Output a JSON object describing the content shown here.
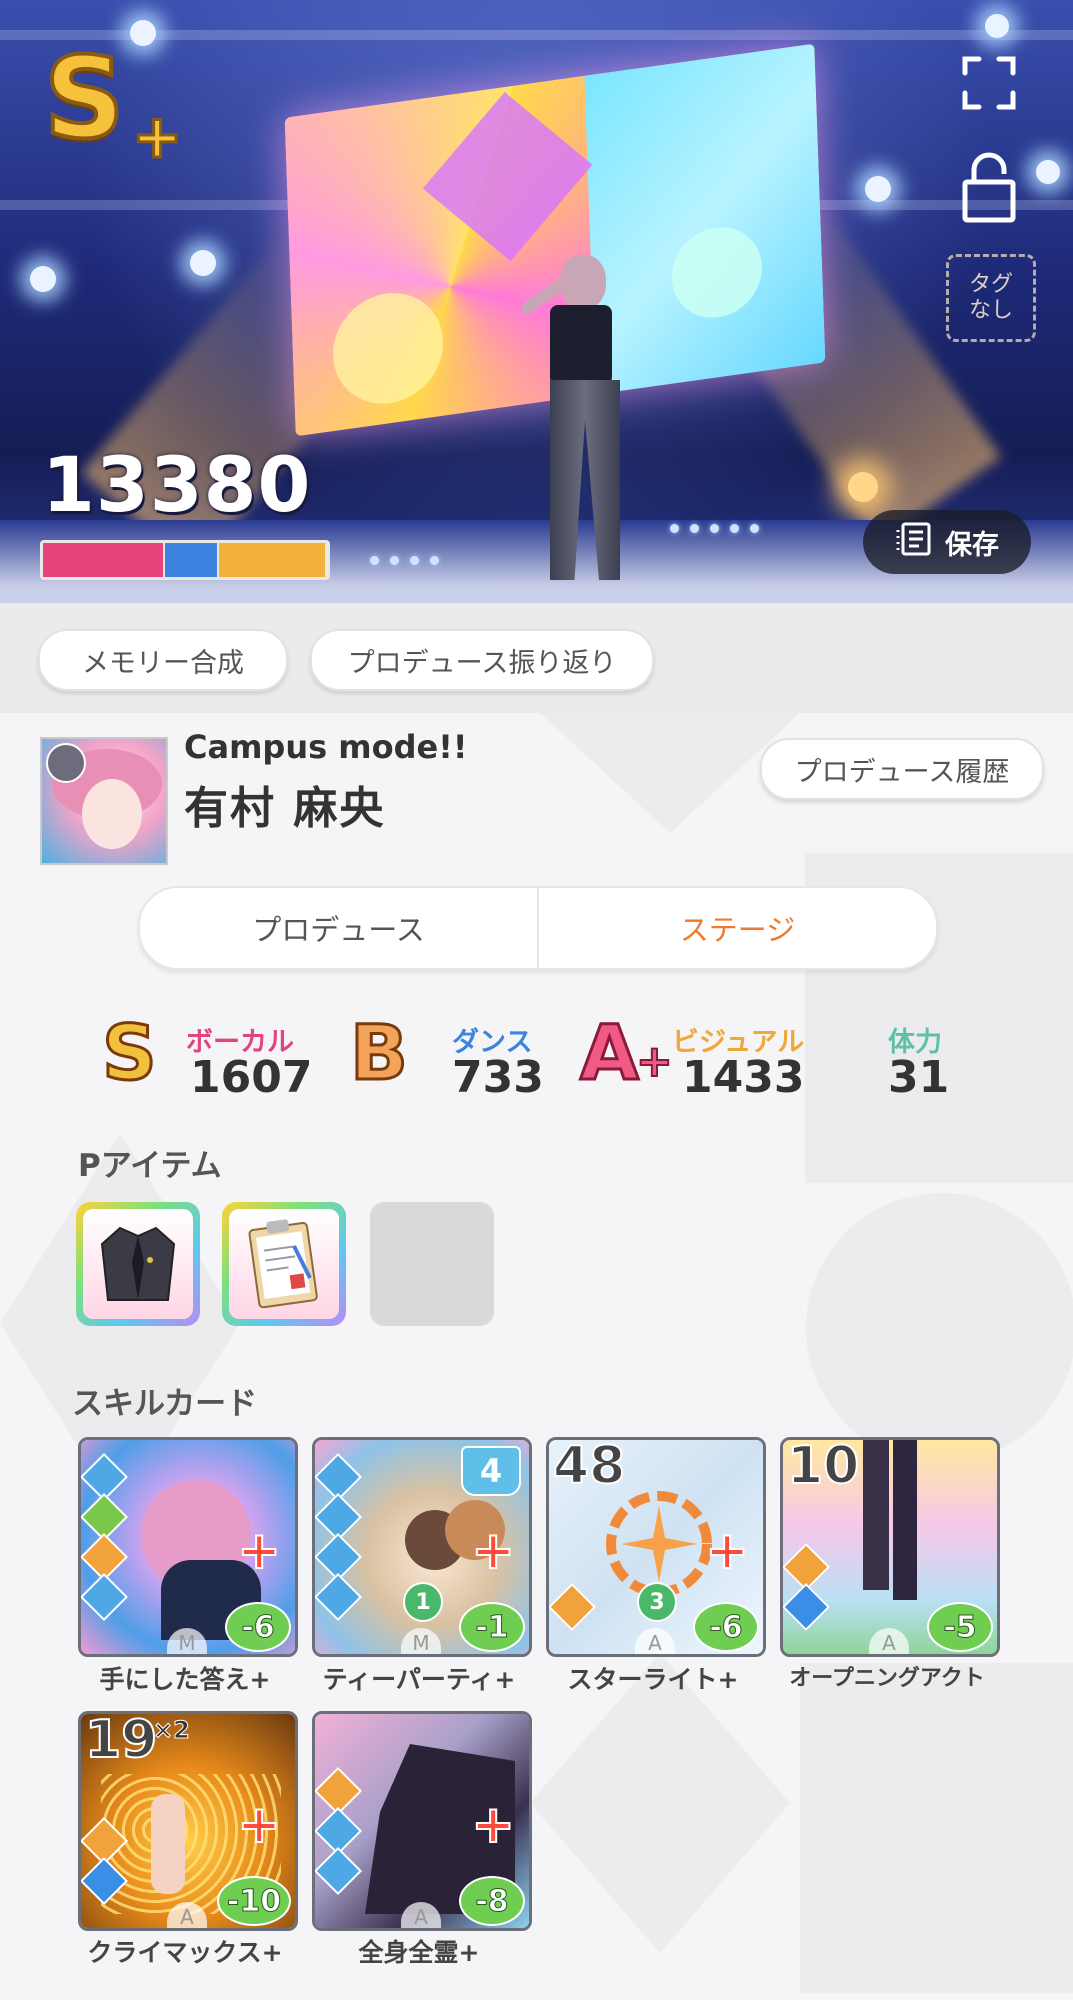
{
  "hero": {
    "rank": "S",
    "rank_suffix": "+",
    "score": "13380",
    "stat_bar": [
      {
        "name": "vocal",
        "share": 0.43,
        "color": "#e6437a"
      },
      {
        "name": "dance",
        "share": 0.19,
        "color": "#3e82e0"
      },
      {
        "name": "visual",
        "share": 0.38,
        "color": "#f2b13a"
      }
    ],
    "tag_line1": "タグ",
    "tag_line2": "なし",
    "save_label": "保存"
  },
  "actions": {
    "memory_merge": "メモリー合成",
    "produce_review": "プロデュース振り返り"
  },
  "card": {
    "subtitle": "Campus mode!!",
    "name": "有村 麻央",
    "history_label": "プロデュース履歴"
  },
  "tabs": {
    "produce": "プロデュース",
    "stage": "ステージ",
    "active": "stage",
    "active_color": "#ef7a2c"
  },
  "stats": {
    "vocal": {
      "rank": "S",
      "label": "ボーカル",
      "value": "1607",
      "color": "#e0457e"
    },
    "dance": {
      "rank": "B",
      "label": "ダンス",
      "value": "733",
      "color": "#3d84dc"
    },
    "visual": {
      "rank": "A",
      "rank_suffix": "+",
      "label": "ビジュアル",
      "value": "1433",
      "color": "#f0a83a"
    },
    "stamina": {
      "label": "体力",
      "value": "31",
      "color": "#5fc1a4"
    }
  },
  "p_items": {
    "title": "Pアイテム",
    "items": [
      {
        "icon": "jacket-icon"
      },
      {
        "icon": "clipboard-icon"
      },
      {
        "icon": "empty-slot"
      }
    ]
  },
  "skill_cards": {
    "title": "スキルカード",
    "cards": [
      {
        "label": "手にした答え+",
        "cost": "-6",
        "rarity": "M"
      },
      {
        "label": "ティーパーティ+",
        "cost": "-1",
        "rarity": "M",
        "badge": "4",
        "number": "1"
      },
      {
        "label": "スターライト+",
        "cost": "-6",
        "rarity": "A",
        "level": "48",
        "number": "3"
      },
      {
        "label": "オープニングアクト",
        "cost": "-5",
        "rarity": "A",
        "level": "10"
      },
      {
        "label": "クライマックス+",
        "cost": "-10",
        "rarity": "A",
        "level": "19",
        "multiplier": "×2"
      },
      {
        "label": "全身全霊+",
        "cost": "-8",
        "rarity": "A"
      }
    ]
  }
}
